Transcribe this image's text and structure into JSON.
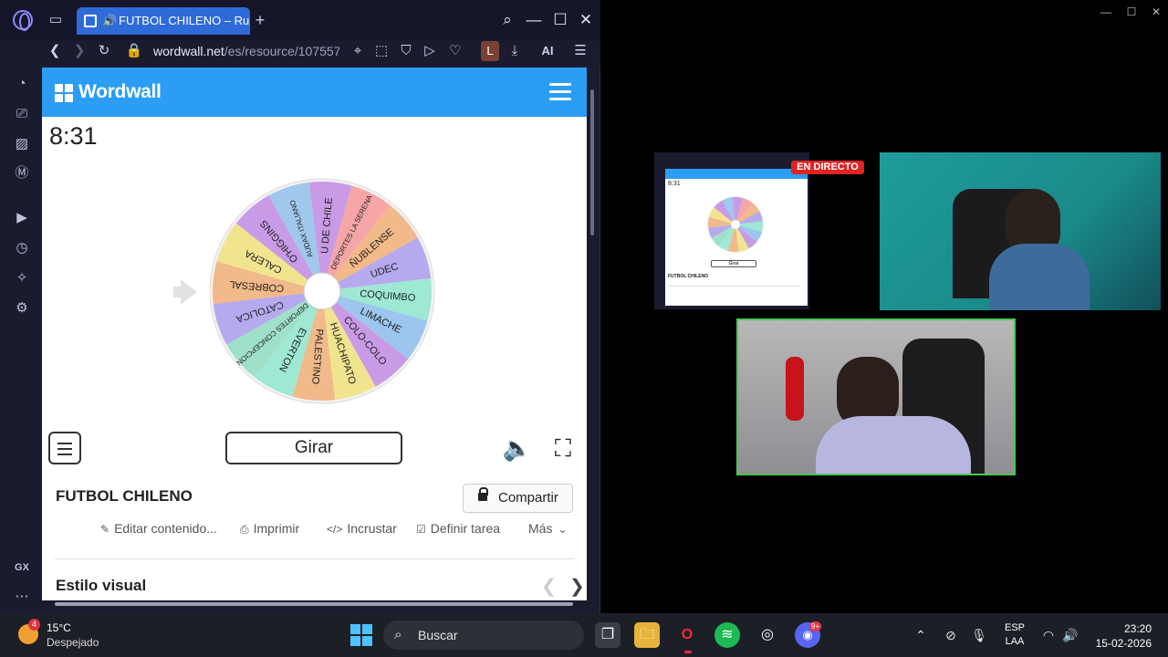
{
  "browser": {
    "tab_title": "FUTBOL CHILENO – Ru",
    "url_host": "wordwall.net",
    "url_path": "/es/resource/107557",
    "profile_letter": "L",
    "ai_label": "AI",
    "sidebar_bottom_label": "GX"
  },
  "wordwall": {
    "logo_text": "Wordwall",
    "timer": "8:31",
    "girar_label": "Girar",
    "activity_title": "FUTBOL CHILENO",
    "share_label": "Compartir",
    "actions": [
      "Editar contenido...",
      "Imprimir",
      "Incrustar",
      "Definir tarea",
      "Más"
    ],
    "visual_style_title": "Estilo visual",
    "wheel_entries": [
      "AUDAX ITALIANO",
      "U DE CHILE",
      "DEPORTES LA SERENA",
      "ÑUBLENSE",
      "UDEC",
      "COQUIMBO",
      "LIMACHE",
      "COLO-COLO",
      "HUACHIPATO",
      "PALESTINO",
      "EVERTON",
      "DEPORTES CONCEPCION",
      "CATOLICA",
      "COBRESAL",
      "CALERA",
      "O'HIGGINS"
    ],
    "wheel_colors": [
      "#9fc8ec",
      "#c99be6",
      "#f6a6a6",
      "#f2b98a",
      "#b7a9ee",
      "#9ee8d4",
      "#9cc6ee",
      "#c99be6",
      "#f1e48e",
      "#f2b98a",
      "#9ee8d4",
      "#9fe0c9",
      "#b7a9ee",
      "#f2b98a",
      "#f1e48e",
      "#c99be6"
    ]
  },
  "stream": {
    "live_label": "EN DIRECTO",
    "mini_timer": "8:31",
    "mini_title": "FUTBOL CHILENO",
    "mini_girar": "Girar"
  },
  "taskbar": {
    "weather_badge": "4",
    "temperature": "15°C",
    "weather": "Despejado",
    "search_label": "Buscar",
    "discord_badge": "9+",
    "lang_top": "ESP",
    "lang_bottom": "LAA",
    "time": "23:20",
    "date": "15-02-2026"
  }
}
